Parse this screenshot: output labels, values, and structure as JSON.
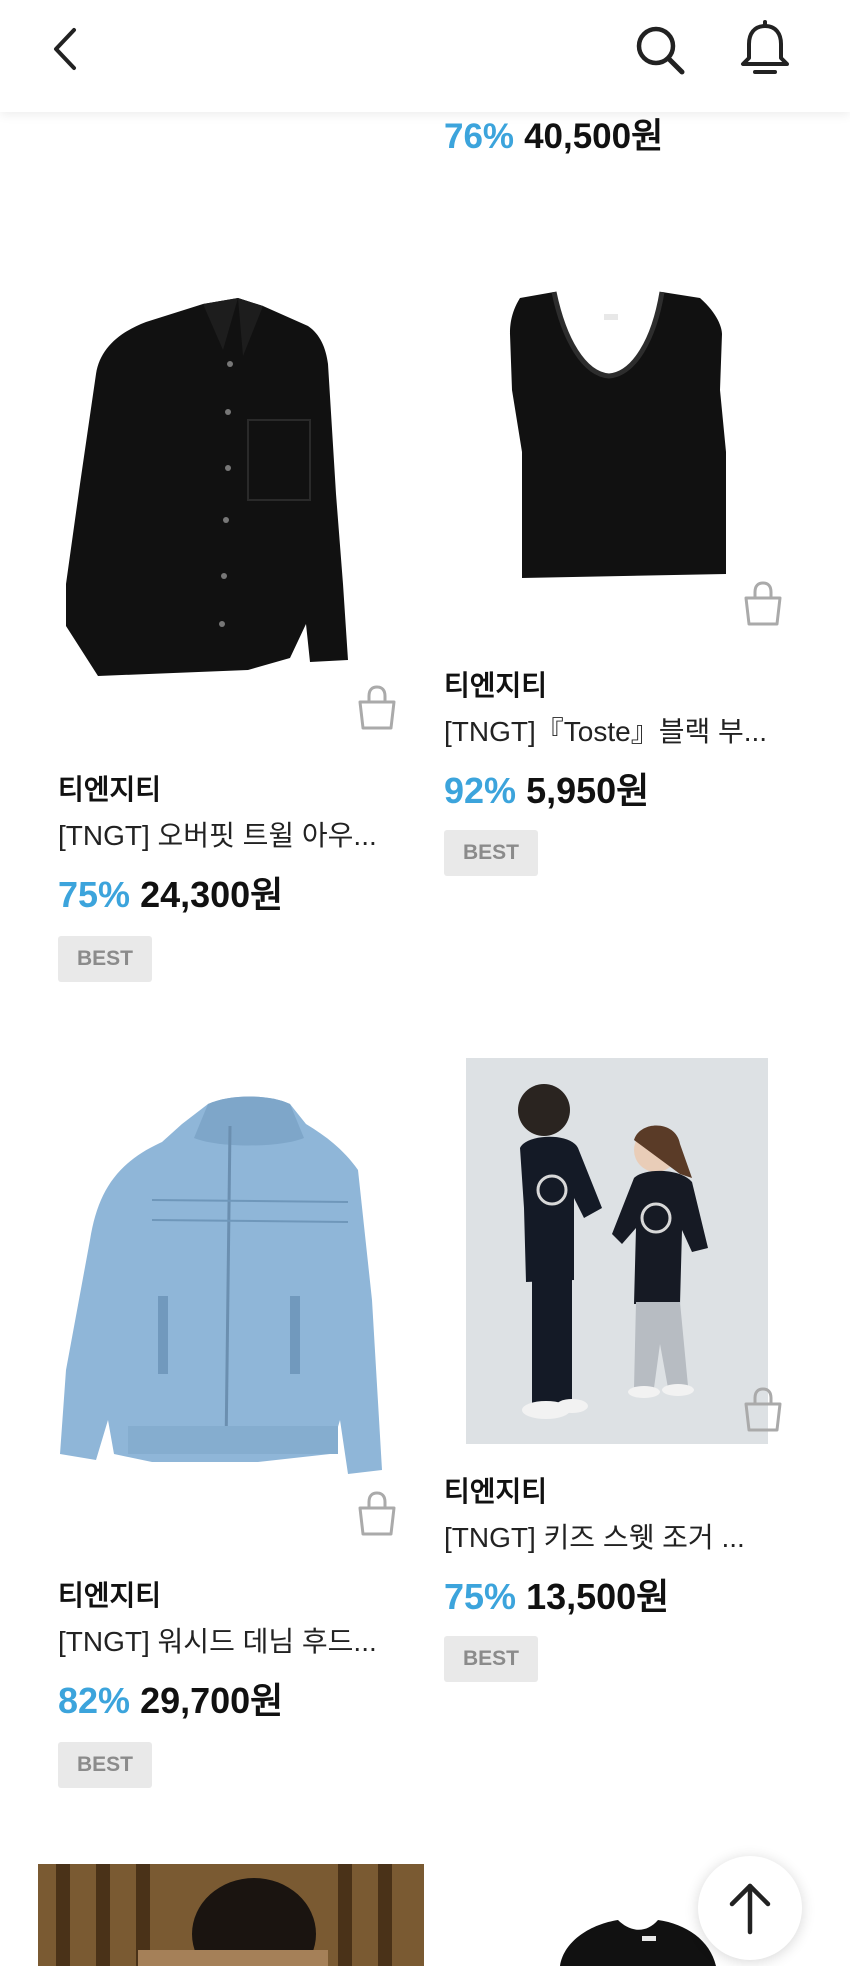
{
  "header": {
    "back_icon": "chevron-left-icon",
    "search_icon": "search-icon",
    "bell_icon": "bell-icon"
  },
  "partial_item": {
    "discount": "76%",
    "price": "40,500원"
  },
  "products": [
    {
      "brand": "티엔지티",
      "name": "[TNGT] 오버핏 트윌 아우...",
      "discount": "75%",
      "price": "24,300원",
      "badge": "BEST",
      "image": "black-overshirt"
    },
    {
      "brand": "티엔지티",
      "name": "[TNGT]『Toste』블랙 부...",
      "discount": "92%",
      "price": "5,950원",
      "badge": "BEST",
      "image": "black-knit-vest"
    },
    {
      "brand": "티엔지티",
      "name": "[TNGT] 워시드 데님 후드...",
      "discount": "82%",
      "price": "29,700원",
      "badge": "BEST",
      "image": "denim-hood-jacket"
    },
    {
      "brand": "티엔지티",
      "name": "[TNGT] 키즈 스웻 조거 ...",
      "discount": "75%",
      "price": "13,500원",
      "badge": "BEST",
      "image": "kids-sweat-photo"
    }
  ],
  "scroll_top_icon": "arrow-up-icon"
}
